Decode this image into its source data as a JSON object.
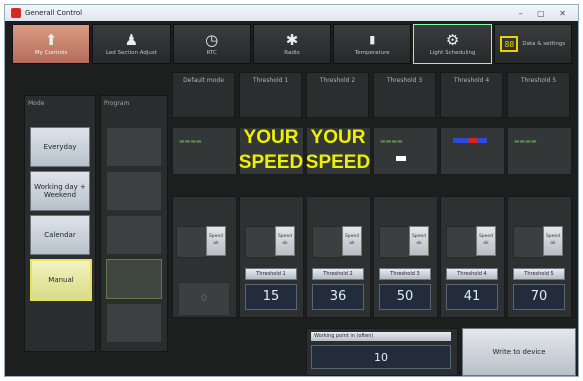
{
  "window": {
    "title": "Generall Control"
  },
  "toolbar": [
    {
      "label": "My Controls",
      "icon": "person-arrow-icon",
      "glyph": "⬆"
    },
    {
      "label": "Led Section Adjust",
      "icon": "person-icon",
      "glyph": "♟"
    },
    {
      "label": "RTC",
      "icon": "clock-icon",
      "glyph": "◷"
    },
    {
      "label": "Radio",
      "icon": "radio-icon",
      "glyph": "✱"
    },
    {
      "label": "Temperature",
      "icon": "thermometer-icon",
      "glyph": "🌡"
    },
    {
      "label": "Light Scheduling",
      "icon": "schedule-icon",
      "glyph": "⚙"
    },
    {
      "label": "Data & settings",
      "icon": "display-icon",
      "glyph": "88"
    }
  ],
  "left": {
    "mode_header": "Mode",
    "program_header": "Program"
  },
  "modes": [
    "Everyday",
    "Working day + Weekend",
    "Calendar",
    "Manual"
  ],
  "columns": [
    "Default mode",
    "Threshold 1",
    "Threshold 2",
    "Threshold 3",
    "Threshold 4",
    "Threshold 5"
  ],
  "speed_text": [
    "YOUR",
    "SPEED",
    "YOUR",
    "SPEED"
  ],
  "switch_label": "Speed ok",
  "thresholds": [
    {
      "label": "Threshold 1",
      "value": "15"
    },
    {
      "label": "Threshold 2",
      "value": "36"
    },
    {
      "label": "Threshold 3",
      "value": "50"
    },
    {
      "label": "Threshold 4",
      "value": "41"
    },
    {
      "label": "Threshold 5",
      "value": "70"
    }
  ],
  "default_value": "0",
  "warning": {
    "label": "Working point in (often)",
    "value": "10"
  },
  "write_button": "Write to device",
  "colors": {
    "accent_yellow": "#eef000",
    "active_tab": "#c7846f"
  }
}
